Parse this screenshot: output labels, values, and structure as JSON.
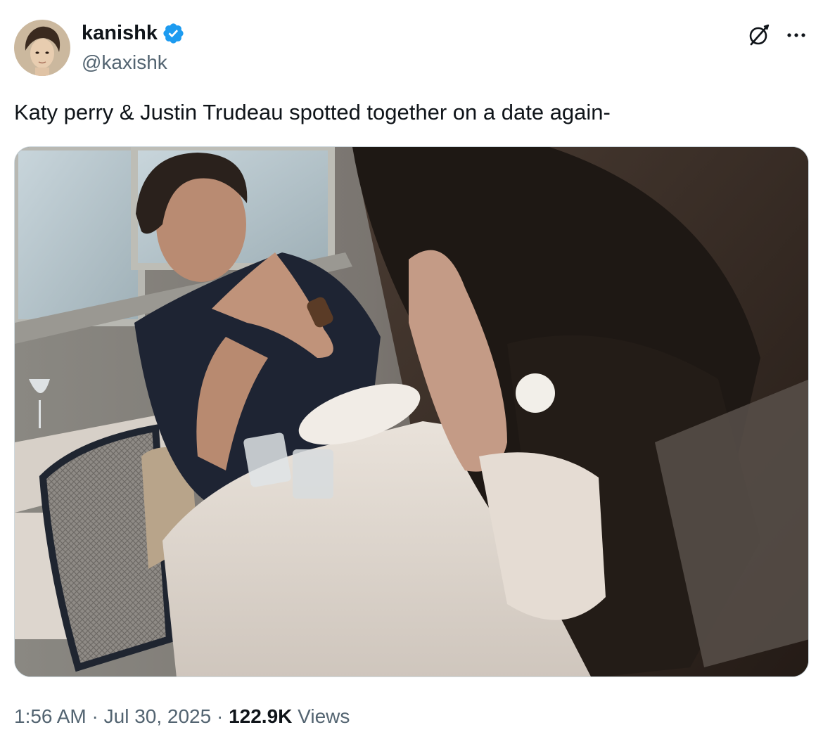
{
  "author": {
    "display_name": "kanishk",
    "handle": "@kaxishk",
    "verified": true,
    "verified_color": "#1d9bf0"
  },
  "tweet": {
    "text": "Katy perry & Justin Trudeau spotted together on a date again-"
  },
  "media": {
    "type": "photo"
  },
  "footer": {
    "time": "1:56 AM",
    "separator": "·",
    "date": "Jul 30, 2025",
    "views_count": "122.9K",
    "views_label": "Views"
  },
  "icons": {
    "grok": "grok-icon",
    "more": "more-dots-icon",
    "verified": "verified-badge-icon"
  }
}
